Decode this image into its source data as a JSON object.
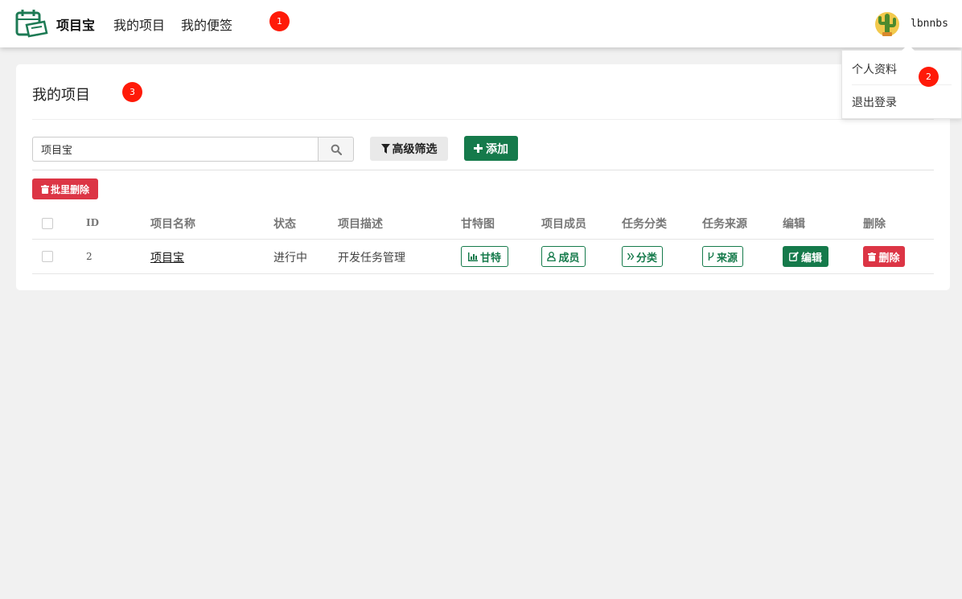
{
  "navbar": {
    "brand": "项目宝",
    "links": [
      "我的项目",
      "我的便签"
    ],
    "username": "lbnnbs"
  },
  "markers": [
    "1",
    "2",
    "3"
  ],
  "user_menu": {
    "items": [
      "个人资料",
      "退出登录"
    ]
  },
  "panel": {
    "title": "我的项目",
    "search": {
      "value": "项目宝",
      "placeholder": ""
    },
    "filter_label": "高级筛选",
    "add_label": "添加",
    "batch_delete_label": "批里删除"
  },
  "table": {
    "headers": [
      "ID",
      "项目名称",
      "状态",
      "项目描述",
      "甘特图",
      "项目成员",
      "任务分类",
      "任务来源",
      "编辑",
      "删除"
    ],
    "rows": [
      {
        "id": "2",
        "name": "项目宝",
        "status": "进行中",
        "description": "开发任务管理",
        "gantt": "甘特",
        "members": "成员",
        "category": "分类",
        "source": "来源",
        "edit": "编辑",
        "delete": "删除"
      }
    ]
  },
  "colors": {
    "primary": "#157a4b",
    "danger": "#dc3545",
    "marker": "#ff1a08",
    "background": "#f1f1f1"
  },
  "icons": [
    "logo-icon",
    "avatar-cactus-icon",
    "search-icon",
    "filter-icon",
    "plus-icon",
    "trash-icon",
    "bar-chart-icon",
    "user-icon",
    "double-chevron-icon",
    "code-fork-icon",
    "edit-icon"
  ]
}
